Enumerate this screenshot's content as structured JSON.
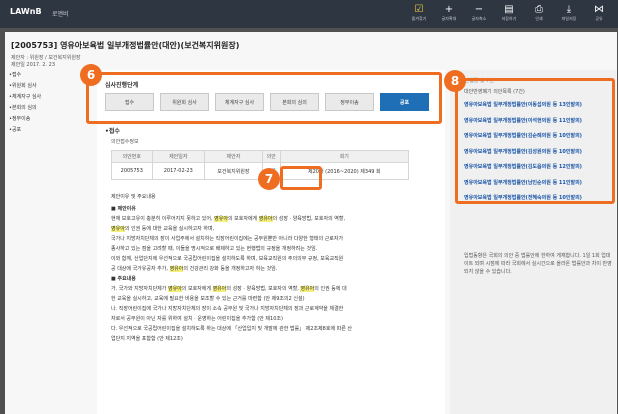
{
  "app": {
    "brand": "LAWnB",
    "brand_sub": "로앤비"
  },
  "toolbar": [
    {
      "name": "tool-bookmark",
      "icon": "check-icon",
      "glyph": "☑",
      "label": "즐겨찾기",
      "selected": true
    },
    {
      "name": "tool-zoom-in",
      "icon": "plus-icon",
      "glyph": "+",
      "label": "글자확대",
      "selected": false
    },
    {
      "name": "tool-zoom-out",
      "icon": "minus-icon",
      "glyph": "−",
      "label": "글자축소",
      "selected": false
    },
    {
      "name": "tool-save",
      "icon": "folder-icon",
      "glyph": "▤",
      "label": "저장하기",
      "selected": false
    },
    {
      "name": "tool-print",
      "icon": "print-icon",
      "glyph": "⎙",
      "label": "인쇄",
      "selected": false
    },
    {
      "name": "tool-download",
      "icon": "download-icon",
      "glyph": "⤓",
      "label": "파일저장",
      "selected": false
    },
    {
      "name": "tool-share",
      "icon": "share-icon",
      "glyph": "⋈",
      "label": "공유",
      "selected": false
    }
  ],
  "doc": {
    "title": "[2005753] 영유아보육법 일부개정법률안(대안)(보건복지위원장)",
    "meta": "제안자 : 위원장 / 보건복지위원장",
    "meta2": "제안일 2017. 2. 23"
  },
  "toc": [
    "•접수",
    "•위원회 심사",
    "•체계자구 심사",
    "•본회의 심의",
    "•정부이송",
    "•공포"
  ],
  "stage": {
    "title": "심사진행단계",
    "items": [
      "접수",
      "위원회 심사",
      "체계자구 심사",
      "본회의 심의",
      "정부이송",
      "공포"
    ],
    "active_index": 5
  },
  "section": {
    "head": "•접수",
    "sub": "의안접수정보"
  },
  "table": {
    "headers": [
      "의안번호",
      "제안일자",
      "제안자",
      "의안",
      "회기"
    ],
    "row": [
      "2005753",
      "2017-02-23",
      "보건복지위원장",
      "원문",
      "제20대 (2016~2020) 제349 회"
    ]
  },
  "content": {
    "sub": "제안이유 및 주요내용",
    "h1": "■ 제안이유",
    "p1": "현재 보호고유이 충분히 이루어지지 못하고 있어, 영유아의 보호자에게 영유아의 성장 · 양육방법, 보호자의 역할,",
    "p2": "영유아의 인권 등에 대한 교육을 실시하고자 하며,",
    "p3": "국가나 지방자치단체의 장이 사업주에서 설치하는 직장어린이집에는 공무원뿐만 아니라 다양한 형태의 근로자가",
    "p4": "종사하고 있는 점을 고려할 때, 이들을 명시적으로 배제하고 있는 현행법의 규정을 개정하려는 것임.",
    "p5": "이와 함께, 산업단지에 우선적으로 국공립어린이집을 설치하도록 하며, 보육교직원의 주의의무 규정, 보육교직원",
    "p6": "공 대상에 국가유공자 추가, 영유아의 건강관리 강화 등을 개정하고자 하는 것임.",
    "h2": "■ 주요내용",
    "p7": "가. 국가와 지방자치단체가 영유아의 보호자에게 영유아의 성장 · 양육방법, 보호자의 역할, 영유아의 인권 등에 대",
    "p8": "한 교육을 실시하고, 교육에 필요한 비용을 보조할 수 있는 근거를 마련함 (안 제9조의2 신설)",
    "p9": "나. 직장어린이집에 국가나 지방자치단체의 장이 소속 공무원 및 국가나 지방자치단체의 장과 근로계약을 체결한",
    "p10": "자로서 공무원이 아닌 자를 위하여 설치 · 운영하는 어린이집을 추가함 (안 제10조)",
    "p11": "다. 우선적으로 국공립어린이집을 설치하도록 하는 대상에 「산업입지 및 개발에 관한 법률」 제2조제8호에 따른 산",
    "p12": "업단지 지역을 포함함 (안 제12조)",
    "highlight": "영유아"
  },
  "side": {
    "title": "관련법률 총 7건",
    "intro": "대안반영폐기 의안목록 (7건)",
    "items": [
      "영유아보육법 일부개정법률안(이동섭의원 등 13인발의)",
      "영유아보육법 일부개정법률안(이석현의원 등 11인발의)",
      "영유아보육법 일부개정법률안(김순례의원 등 10인발의)",
      "영유아보육법 일부개정법률안(김성원의원 등 10인발의)",
      "영유아보육법 일부개정법률안(김도읍의원 등 12인발의)",
      "영유아보육법 일부개정법률안(남인순의원 등 11인발의)",
      "영유아보육법 일부개정법률안(전혜숙의원 등 10인발의)"
    ],
    "note": "입법동향은 국회의 의안 중 법률안에 한하여 게재합니다. 1일 1회 업데이트 되며 시점에 따라 국회에서 실시간으로 올라온 법률안과 차이 반영되지 않을 수 있습니다."
  },
  "callouts": {
    "six": "6",
    "seven": "7",
    "eight": "8"
  },
  "colors": {
    "accent_orange": "#ef6d20",
    "active_blue": "#1f6fb6",
    "topbar": "#2e3642"
  }
}
